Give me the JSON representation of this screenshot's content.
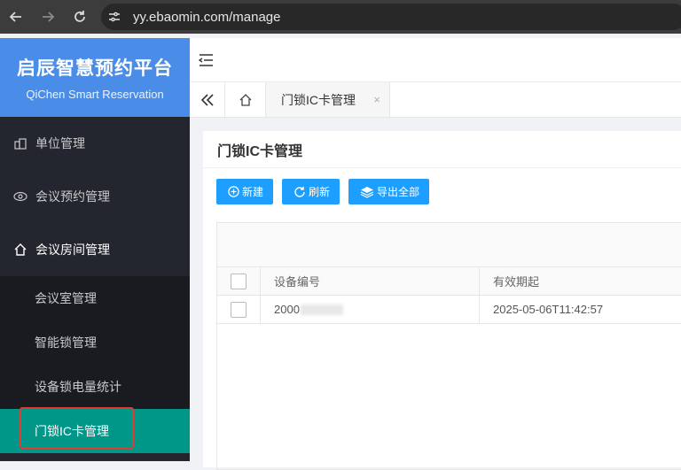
{
  "browser": {
    "url": "yy.ebaomin.com/manage"
  },
  "sidebar": {
    "brand_title": "启辰智慧预约平台",
    "brand_subtitle": "QiChen Smart Reservation",
    "items": [
      {
        "label": "单位管理",
        "icon": "building-icon"
      },
      {
        "label": "会议预约管理",
        "icon": "eye-icon"
      },
      {
        "label": "会议房间管理",
        "icon": "home-icon"
      }
    ],
    "subitems": [
      {
        "label": "会议室管理"
      },
      {
        "label": "智能锁管理"
      },
      {
        "label": "设备锁电量统计"
      },
      {
        "label": "门锁IC卡管理",
        "active": true
      }
    ]
  },
  "tabs": {
    "current": "门锁IC卡管理",
    "close": "×"
  },
  "page": {
    "title": "门锁IC卡管理",
    "buttons": {
      "new": "新建",
      "refresh": "刷新",
      "export": "导出全部"
    }
  },
  "table": {
    "columns": [
      "设备编号",
      "有效期起"
    ],
    "rows": [
      {
        "device_no": "2000",
        "valid_from": "2025-05-06T11:42:57"
      }
    ]
  },
  "colors": {
    "brand": "#4a8de8",
    "sidebar_bg": "#23262e",
    "active_item": "#009688",
    "primary_button": "#1e9fff",
    "highlight_border": "#e23b2f"
  }
}
